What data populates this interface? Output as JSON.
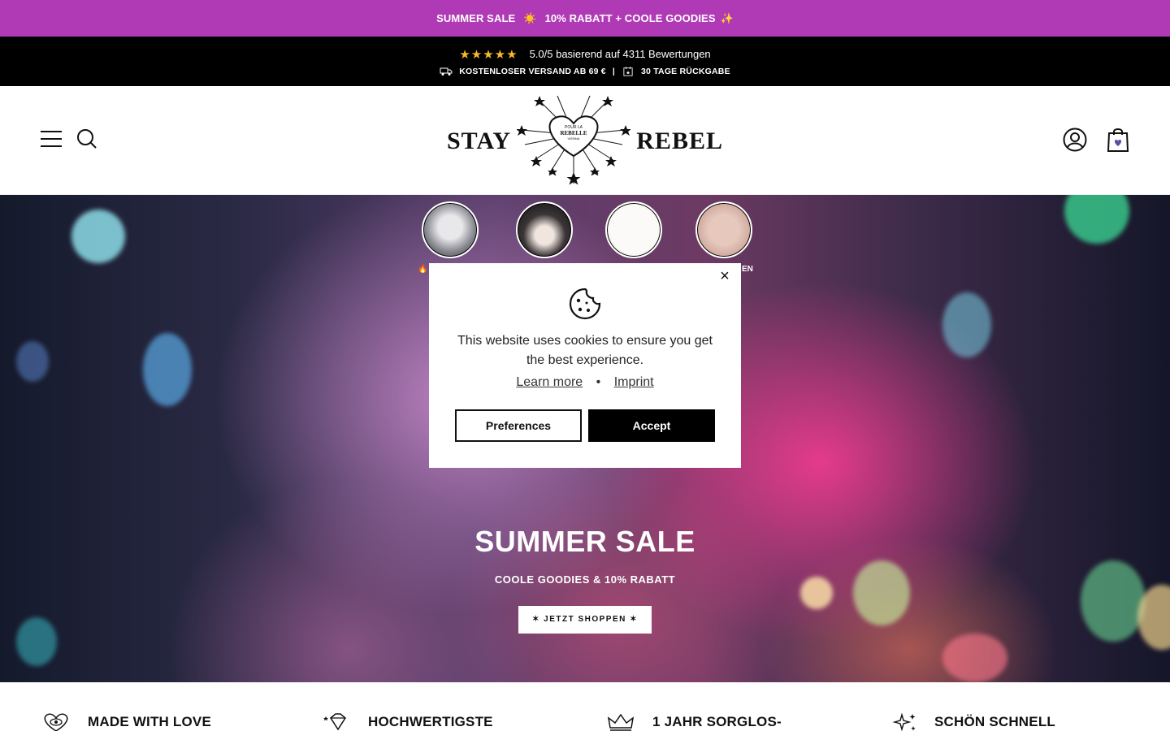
{
  "promo": {
    "left": "SUMMER SALE",
    "sun": "☀️",
    "right": "10% RABATT + COOLE GOODIES",
    "sparkle": "✨"
  },
  "trust": {
    "stars": "★★★★★",
    "rating": "5.0/5 basierend auf 4311 Bewertungen",
    "shipping": "KOSTENLOSER VERSAND AB 69 €",
    "separator": "|",
    "returns": "30 TAGE RÜCKGABE"
  },
  "header": {
    "logo_left": "STAY",
    "logo_right": "REBEL",
    "logo_badge_top": "POUR LA",
    "logo_badge_mid": "REBELLE",
    "logo_badge_bot": "VIENNA",
    "icons": [
      "menu-icon",
      "search-icon",
      "account-icon",
      "cart-icon"
    ]
  },
  "categories": {
    "label_left": "🔥",
    "label_right": "EN"
  },
  "hero": {
    "title": "SUMMER SALE",
    "subtitle": "COOLE GOODIES & 10% RABATT",
    "cta": "✶ JETZT SHOPPEN ✶"
  },
  "cookie": {
    "message": "This website uses cookies to ensure you get the best experience.",
    "learn_more": "Learn more",
    "dot": "•",
    "imprint": "Imprint",
    "preferences": "Preferences",
    "accept": "Accept",
    "close": "×"
  },
  "features": [
    {
      "label": "MADE WITH LOVE",
      "icon": "heart-eye-icon"
    },
    {
      "label": "HOCHWERTIGSTE",
      "icon": "diamond-icon"
    },
    {
      "label": "1 JAHR SORGLOS-",
      "icon": "crown-icon"
    },
    {
      "label": "SCHÖN SCHNELL",
      "icon": "sparkle-icon"
    }
  ],
  "colors": {
    "promo_bg": "#b03ab6",
    "trust_bg": "#000000",
    "accept_bg": "#000000",
    "star": "#f7b928"
  }
}
